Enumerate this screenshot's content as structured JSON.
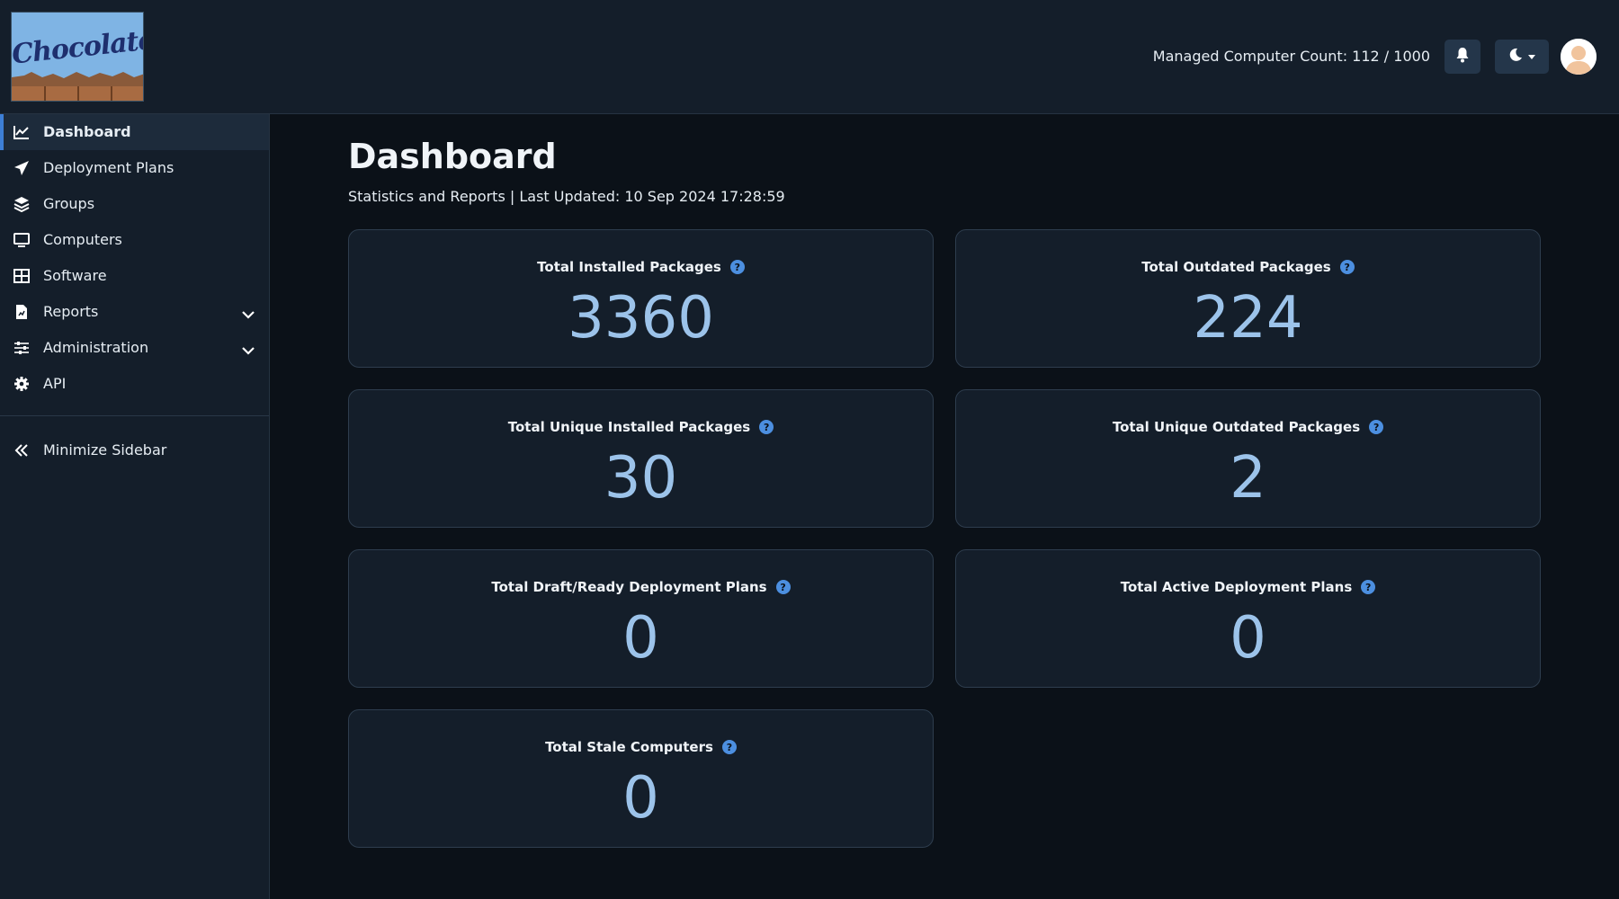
{
  "header": {
    "logo_text": "Chocolatey",
    "managed_count": "Managed Computer Count: 112 / 1000"
  },
  "sidebar": {
    "items": [
      {
        "label": "Dashboard",
        "icon": "chart-line-icon",
        "active": true
      },
      {
        "label": "Deployment Plans",
        "icon": "paper-plane-icon"
      },
      {
        "label": "Groups",
        "icon": "layers-icon"
      },
      {
        "label": "Computers",
        "icon": "monitor-icon"
      },
      {
        "label": "Software",
        "icon": "grid-icon"
      },
      {
        "label": "Reports",
        "icon": "report-file-icon",
        "expandable": true
      },
      {
        "label": "Administration",
        "icon": "sliders-icon",
        "expandable": true
      },
      {
        "label": "API",
        "icon": "gear-icon"
      }
    ],
    "minimize_label": "Minimize Sidebar"
  },
  "main": {
    "title": "Dashboard",
    "subtitle": "Statistics and Reports | Last Updated: 10 Sep 2024 17:28:59",
    "cards": [
      {
        "label": "Total Installed Packages",
        "value": "3360"
      },
      {
        "label": "Total Outdated Packages",
        "value": "224"
      },
      {
        "label": "Total Unique Installed Packages",
        "value": "30"
      },
      {
        "label": "Total Unique Outdated Packages",
        "value": "2"
      },
      {
        "label": "Total Draft/Ready Deployment Plans",
        "value": "0"
      },
      {
        "label": "Total Active Deployment Plans",
        "value": "0"
      },
      {
        "label": "Total Stale Computers",
        "value": "0"
      }
    ],
    "help_glyph": "?"
  },
  "colors": {
    "background": "#0b1118",
    "panel": "#141e2a",
    "accent": "#3d7fd6",
    "value_text": "#9cc3ea"
  }
}
